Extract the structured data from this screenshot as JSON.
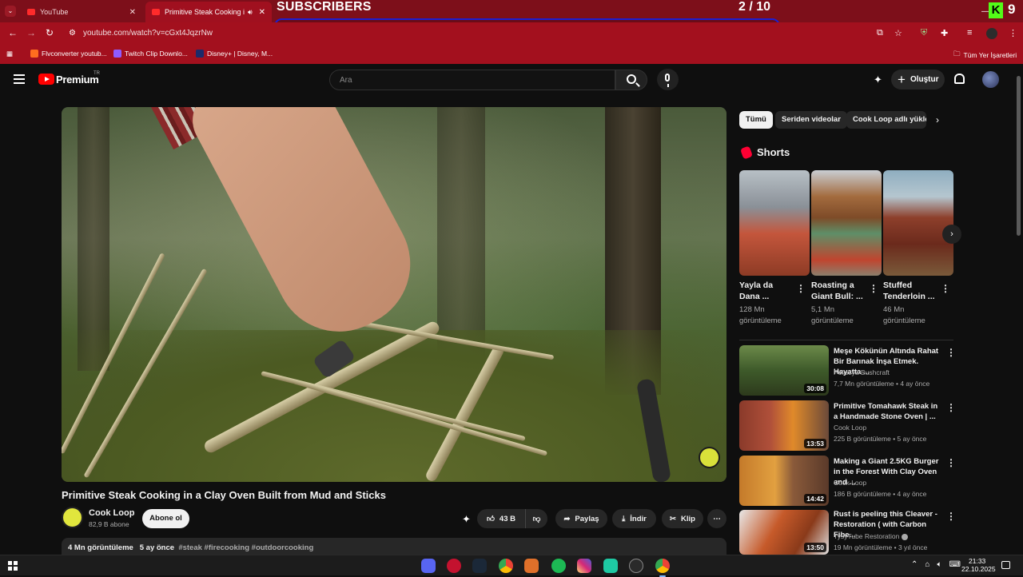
{
  "browser": {
    "tabs": [
      {
        "title": "YouTube",
        "active": false
      },
      {
        "title": "Primitive Steak Cooking in a",
        "active": true
      }
    ],
    "url": "youtube.com/watch?v=cGxt4JqzrNw",
    "bookmarks": [
      "Flvconverter youtub...",
      "Twitch Clip Downlo...",
      "Disney+ | Disney, M..."
    ],
    "bookmarks_folder": "Tüm Yer İşaretleri"
  },
  "overlay": {
    "label": "SUBSCRIBERS",
    "count": "2  / 10",
    "progress": 0.2,
    "kick_letter": "K",
    "kick_number": "9",
    "bar_color": "#1d1fd4"
  },
  "yt_header": {
    "brand": "Premium",
    "country": "TR",
    "search_placeholder": "Ara",
    "create_label": "Oluştur"
  },
  "video": {
    "title": "Primitive Steak Cooking in a Clay Oven Built from Mud and Sticks",
    "channel_name": "Cook Loop",
    "channel_subs": "82,9 B abone",
    "subscribe_label": "Abone ol",
    "likes": "43 B",
    "share_label": "Paylaş",
    "download_label": "İndir",
    "clip_label": "Klip",
    "views": "4 Mn görüntüleme",
    "age": "5 ay önce",
    "tags": "#steak #firecooking #outdoorcooking"
  },
  "chips": [
    "Tümü",
    "Seriden videolar",
    "Cook Loop adlı yükleyiciden"
  ],
  "shorts": {
    "heading": "Shorts",
    "items": [
      {
        "title": "Yayla da Dana ...",
        "views": "128 Mn görüntüleme"
      },
      {
        "title": "Roasting a Giant Bull: ...",
        "views": "5,1 Mn görüntüleme"
      },
      {
        "title": "Stuffed Tenderloin ...",
        "views": "46 Mn görüntüleme"
      }
    ]
  },
  "recommendations": [
    {
      "title": "Meşe Kökünün Altında Rahat Bir Barınak İnşa Etmek. Hayatta ...",
      "channel": "Polissya Bushcraft",
      "views": "7,7 Mn görüntüleme",
      "age": "4 ay önce",
      "duration": "30:08",
      "verified": false
    },
    {
      "title": "Primitive Tomahawk Steak in a Handmade Stone Oven | ...",
      "channel": "Cook Loop",
      "views": "225 B görüntüleme",
      "age": "5 ay önce",
      "duration": "13:53",
      "verified": false
    },
    {
      "title": "Making a Giant 2.5KG Burger in the Forest With Clay Oven and ...",
      "channel": "Cook Loop",
      "views": "186 B görüntüleme",
      "age": "4 ay önce",
      "duration": "14:42",
      "verified": false
    },
    {
      "title": "Rust is peeling this Cleaver - Restoration ( with Carbon Fibe...",
      "channel": "TysyTube Restoration",
      "views": "19 Mn görüntüleme",
      "age": "3 yıl önce",
      "duration": "13:50",
      "verified": true
    }
  ],
  "taskbar": {
    "time": "21:33",
    "date": "22.10.2025"
  }
}
